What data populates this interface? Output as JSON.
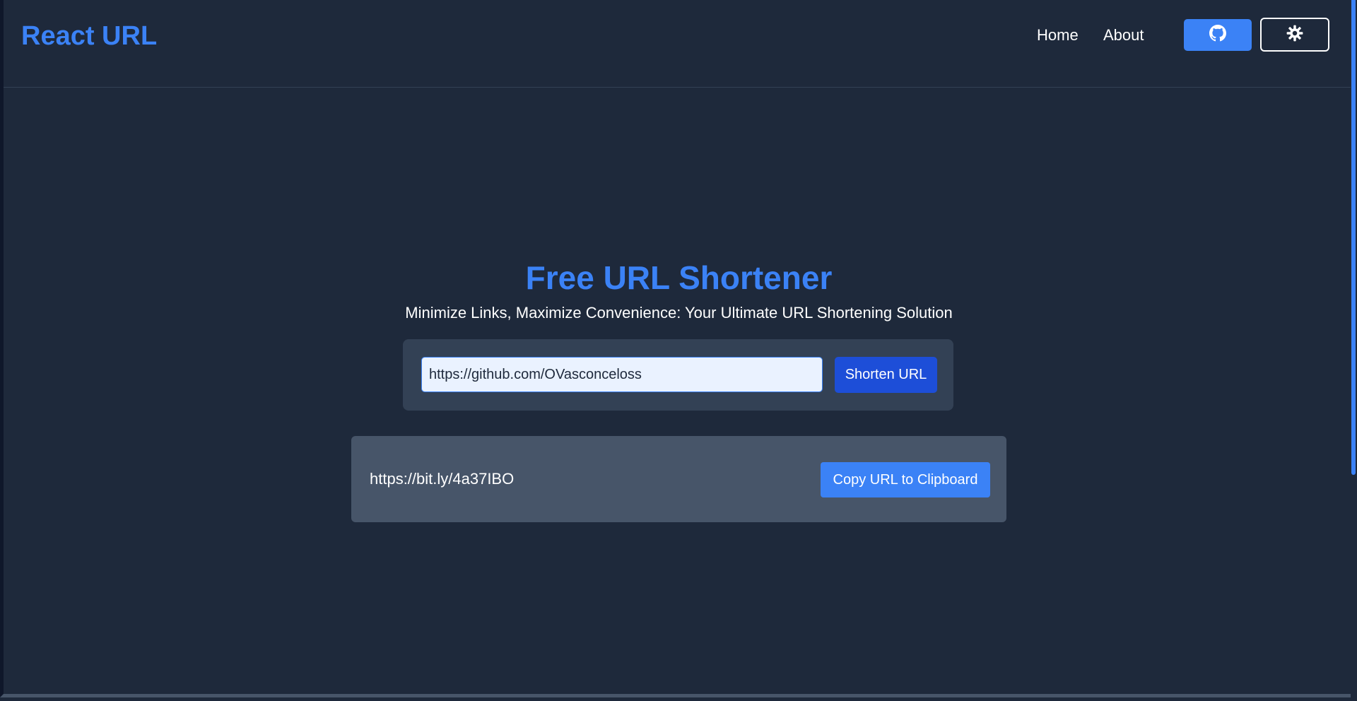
{
  "header": {
    "brand": "React URL",
    "nav": [
      {
        "label": "Home"
      },
      {
        "label": "About"
      }
    ],
    "github_icon": "github-icon",
    "theme_icon": "gear-icon"
  },
  "hero": {
    "title": "Free URL Shortener",
    "subtitle": "Minimize Links, Maximize Convenience: Your Ultimate URL Shortening Solution"
  },
  "form": {
    "input_value": "https://github.com/OVasconceloss",
    "shorten_label": "Shorten URL"
  },
  "result": {
    "short_url": "https://bit.ly/4a37IBO",
    "copy_label": "Copy URL to Clipboard"
  },
  "colors": {
    "background": "#1e293b",
    "accent": "#3b82f6",
    "accent_dark": "#1d4ed8",
    "card": "#334155",
    "result_card": "#475569"
  }
}
